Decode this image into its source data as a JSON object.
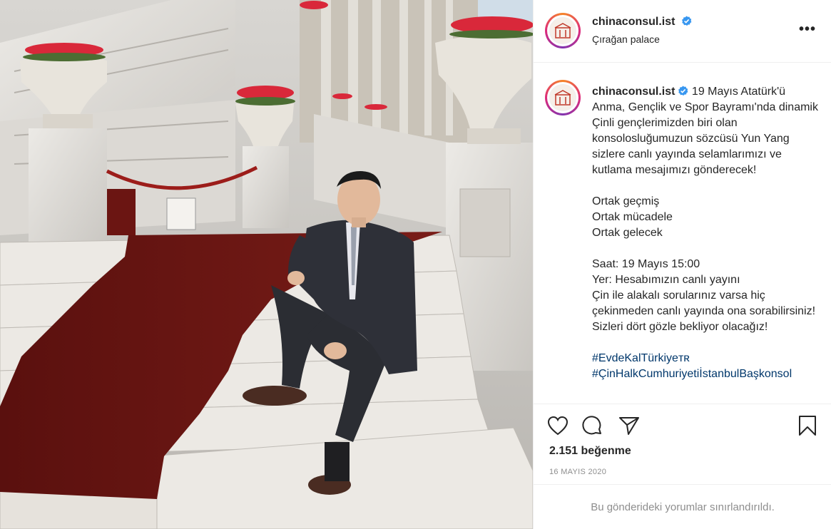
{
  "post": {
    "author": {
      "username": "chinaconsul.ist",
      "verified": true,
      "location": "Çırağan palace"
    },
    "more_icon": "ellipsis-icon",
    "caption": {
      "username": "chinaconsul.ist",
      "paragraph1": "19 Mayıs Atatürk'ü Anma, Gençlik ve Spor Bayramı'nda dinamik Çinli gençlerimizden biri olan konsolosluğumuzun sözcüsü Yun Yang sizlere canlı yayında selamlarımızı ve kutlama mesajımızı gönderecek!",
      "lines2": [
        "Ortak geçmiş",
        "Ortak mücadele",
        "Ortak gelecek"
      ],
      "lines3": [
        "Saat: 19 Mayıs 15:00",
        "Yer: Hesabımızın canlı yayını"
      ],
      "paragraph3b": "Çin ile alakalı sorularınız varsa hiç çekinmeden canlı yayında ona sorabilirsiniz! Sizleri dört gözle bekliyor olacağız!",
      "hashtags": [
        "#EvdeKalTürkiyeᴛʀ",
        "#ÇinHalkCumhuriyetiİstanbulBaşkonsol"
      ]
    },
    "actions": {
      "like_icon": "heart-icon",
      "comment_icon": "comment-icon",
      "share_icon": "paper-plane-icon",
      "save_icon": "bookmark-icon"
    },
    "likes_text": "2.151 beğenme",
    "date": "16 MAYIS 2020",
    "comments_notice": "Bu gönderideki yorumlar sınırlandırıldı."
  },
  "colors": {
    "verified_blue": "#3897f0",
    "hashtag_blue": "#00376b",
    "muted_gray": "#8e8e8e",
    "carpet_red": "#6b1512"
  }
}
